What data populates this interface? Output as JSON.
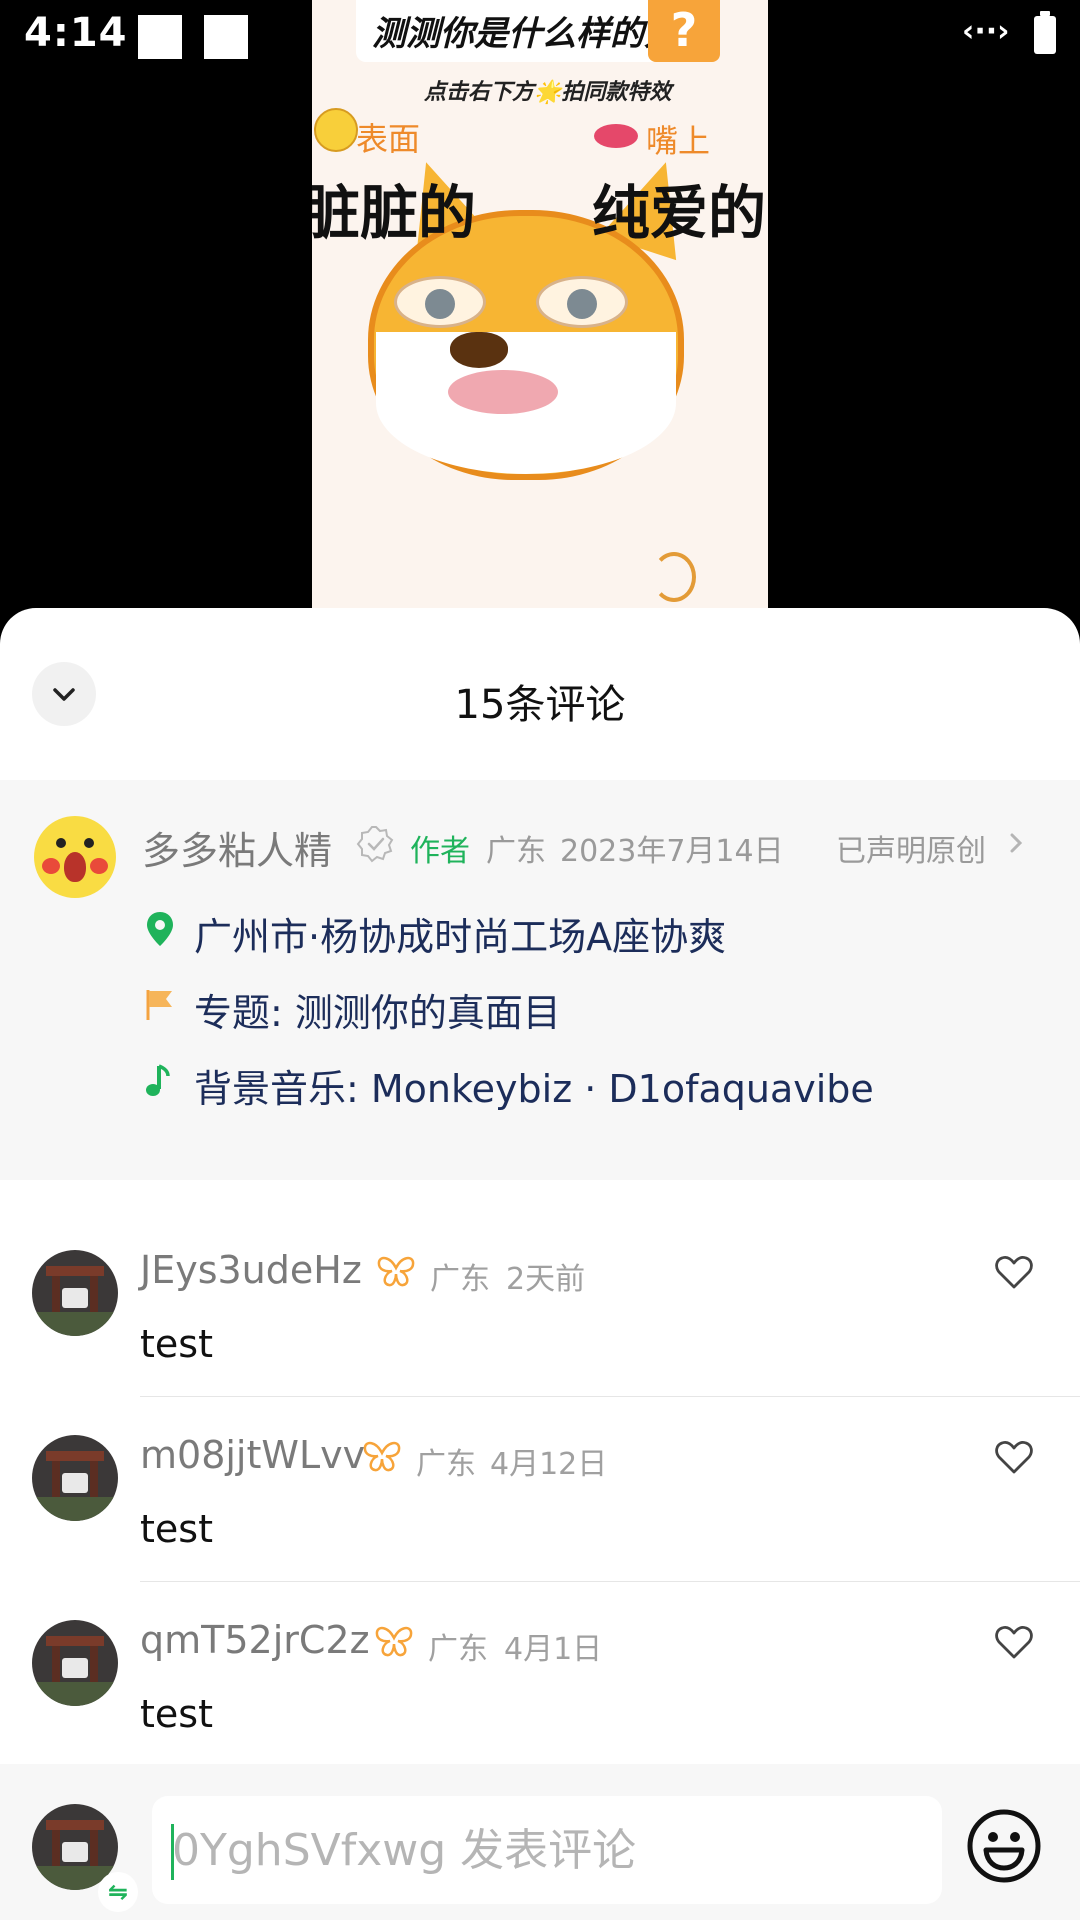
{
  "status_bar": {
    "time": "4:14",
    "data_icon": "‹··›"
  },
  "video": {
    "title": "测测你是什么样的人",
    "question_mark": "?",
    "hint": "点击右下方🌟拍同款特效",
    "surface_label": "表面",
    "mouth_label": "嘴上",
    "dirty_text": "脏脏的",
    "pure_text": "纯爱的"
  },
  "sheet": {
    "title": "15条评论"
  },
  "author": {
    "name": "多多粘人精",
    "tag": "作者",
    "region": "广东",
    "date": "2023年7月14日",
    "original": "已声明原创"
  },
  "info": {
    "location": "广州市·杨协成时尚工场A座协爽",
    "topic": "专题: 测测你的真面目",
    "music": "背景音乐: Monkeybiz · D1ofaquavibe"
  },
  "comments": [
    {
      "name": "JEys3udeHz",
      "region": "广东",
      "time": "2天前",
      "text": "test"
    },
    {
      "name": "m08jjtWLvv",
      "region": "广东",
      "time": "4月12日",
      "text": "test"
    },
    {
      "name": "qmT52jrC2z",
      "region": "广东",
      "time": "4月1日",
      "text": "test"
    }
  ],
  "composer": {
    "placeholder": "0YghSVfxwg 发表评论",
    "switch_icon": "⇋"
  },
  "colors": {
    "accent_green": "#1fb35b",
    "badge_orange": "#f7a43a",
    "link_navy": "#1c2d5a"
  },
  "icons": {
    "collapse": "chevron-down-icon",
    "verify": "verified-shield-icon",
    "location": "location-pin-icon",
    "topic": "flag-icon",
    "music": "music-note-icon",
    "like": "heart-icon",
    "emoji": "emoji-smile-icon"
  }
}
